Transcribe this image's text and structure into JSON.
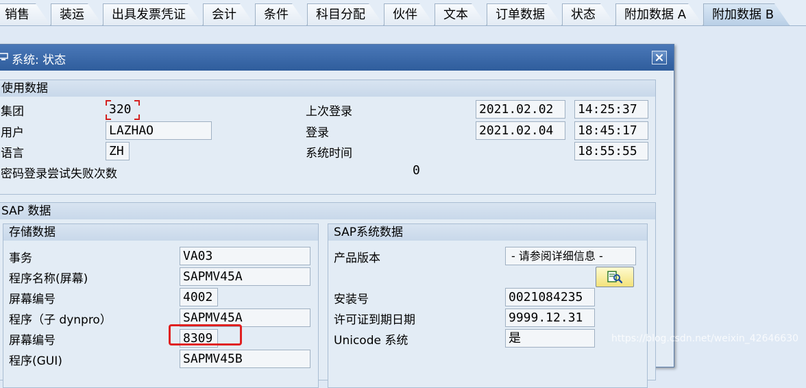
{
  "tabs": [
    {
      "label": "销售"
    },
    {
      "label": "装运"
    },
    {
      "label": "出具发票凭证"
    },
    {
      "label": "会计"
    },
    {
      "label": "条件"
    },
    {
      "label": "科目分配"
    },
    {
      "label": "伙伴"
    },
    {
      "label": "文本"
    },
    {
      "label": "订单数据"
    },
    {
      "label": "状态"
    },
    {
      "label": "附加数据 A"
    },
    {
      "label": "附加数据 B"
    }
  ],
  "active_tab": "附加数据 B",
  "dialog": {
    "title": "系统: 状态",
    "close_icon": "close-icon",
    "usage_data": {
      "header": "使用数据",
      "client_label": "集团",
      "client_value": "320",
      "user_label": "用户",
      "user_value": "LAZHAO",
      "language_label": "语言",
      "language_value": "ZH",
      "failed_logons_label": "密码登录尝试失败次数",
      "failed_logons_value": "0",
      "last_logon_label": "上次登录",
      "last_logon_date": "2021.02.02",
      "last_logon_time": "14:25:37",
      "logon_label": "登录",
      "logon_date": "2021.02.04",
      "logon_time": "18:45:17",
      "system_time_label": "系统时间",
      "system_time_value": "18:55:55"
    },
    "sap_data": {
      "header": "SAP 数据",
      "repository": {
        "header": "存储数据",
        "transaction_label": "事务",
        "transaction_value": "VA03",
        "program_screen_label": "程序名称(屏幕)",
        "program_screen_value": "SAPMV45A",
        "screen_number_label": "屏幕编号",
        "screen_number_value": "4002",
        "sub_program_label": "程序（子 dynpro）",
        "sub_program_value": "SAPMV45A",
        "sub_screen_number_label": "屏幕编号",
        "sub_screen_number_value": "8309",
        "gui_program_label": "程序(GUI)",
        "gui_program_value": "SAPMV45B"
      },
      "system": {
        "header": "SAP系统数据",
        "product_version_label": "产品版本",
        "product_version_value": "- 请参阅详细信息 -",
        "details_icon": "details-icon",
        "installation_label": "安装号",
        "installation_value": "0021084235",
        "license_expiry_label": "许可证到期日期",
        "license_expiry_value": "9999.12.31",
        "unicode_label": "Unicode 系统",
        "unicode_value": "是"
      }
    }
  },
  "watermark": "https://blog.csdn.net/weixin_42646630",
  "colors": {
    "title_bar": "#3a68a8",
    "highlight": "#e02020",
    "background": "#dfe9f5"
  }
}
